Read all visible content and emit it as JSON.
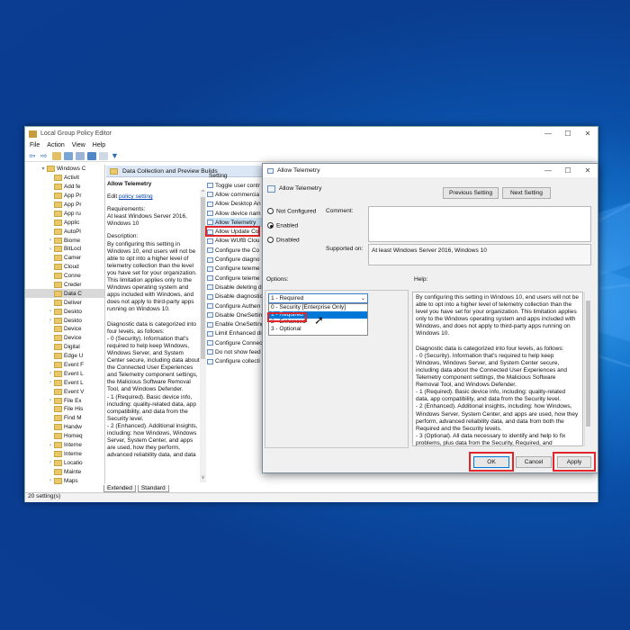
{
  "window": {
    "title": "Local Group Policy Editor",
    "min_glyph": "—",
    "max_glyph": "☐",
    "close_glyph": "✕"
  },
  "menu": [
    "File",
    "Action",
    "View",
    "Help"
  ],
  "tree": [
    {
      "label": "Windows C",
      "caret": "▾"
    },
    {
      "label": "Activit",
      "caret": ""
    },
    {
      "label": "Add fe",
      "caret": ""
    },
    {
      "label": "App Pr",
      "caret": ""
    },
    {
      "label": "App Pr",
      "caret": ""
    },
    {
      "label": "App ru",
      "caret": ""
    },
    {
      "label": "Applic",
      "caret": ""
    },
    {
      "label": "AutoPl",
      "caret": ""
    },
    {
      "label": "Biome",
      "caret": "›"
    },
    {
      "label": "BitLocl",
      "caret": "›"
    },
    {
      "label": "Camer",
      "caret": ""
    },
    {
      "label": "Cloud",
      "caret": ""
    },
    {
      "label": "Conne",
      "caret": ""
    },
    {
      "label": "Creder",
      "caret": ""
    },
    {
      "label": "Data C",
      "caret": ""
    },
    {
      "label": "Deliver",
      "caret": ""
    },
    {
      "label": "Deskto",
      "caret": "›"
    },
    {
      "label": "Deskto",
      "caret": "›"
    },
    {
      "label": "Device",
      "caret": ""
    },
    {
      "label": "Device",
      "caret": ""
    },
    {
      "label": "Digital",
      "caret": ""
    },
    {
      "label": "Edge U",
      "caret": ""
    },
    {
      "label": "Event F",
      "caret": ""
    },
    {
      "label": "Event L",
      "caret": "›"
    },
    {
      "label": "Event L",
      "caret": "›"
    },
    {
      "label": "Event V",
      "caret": ""
    },
    {
      "label": "File Ex",
      "caret": "›"
    },
    {
      "label": "File His",
      "caret": ""
    },
    {
      "label": "Find M",
      "caret": ""
    },
    {
      "label": "Handw",
      "caret": ""
    },
    {
      "label": "Homeq",
      "caret": ""
    },
    {
      "label": "Interne",
      "caret": "›"
    },
    {
      "label": "Interne",
      "caret": ""
    },
    {
      "label": "Locatio",
      "caret": "›"
    },
    {
      "label": "Mainte",
      "caret": ""
    },
    {
      "label": "Maps",
      "caret": "›"
    }
  ],
  "header": {
    "title": "Data Collection and Preview Builds"
  },
  "desc": {
    "title": "Allow Telemetry",
    "edit_prefix": "Edit ",
    "edit_link": "policy setting",
    "requirements": "Requirements:",
    "req_text": "At least Windows Server 2016, Windows 10",
    "description_label": "Description:",
    "body": "By configuring this setting in Windows 10, end users will not be able to opt into a higher level of telemetry collection than the level you have set for your organization. This limitation applies only to the Windows operating system and apps included with Windows, and does not apply to third-party apps running on Windows 10.\n\nDiagnostic data is categorized into four levels, as follows:\n - 0 (Security). Information that's required to help keep Windows, Windows Server, and System Center secure, including data about the Connected User Experiences and Telemetry component settings, the Malicious Software Removal Tool, and Windows Defender.\n - 1 (Required). Basic device info, including: quality-related data, app compatibility, and data from the Security level.\n - 2 (Enhanced). Additional insights, including: how Windows, Windows Server, System Center, and apps are used, how they perform, advanced reliability data, and data"
  },
  "settings": {
    "header": "Setting",
    "items": [
      "Toggle user contr",
      "Allow commercia",
      "Allow Desktop An",
      "Allow device nam",
      "Allow Telemetry",
      "Allow Update Co",
      "Allow WUfB Clou",
      "Configure the Co",
      "Configure diagno",
      "Configure teleme",
      "Configure teleme",
      "Disable deleting d",
      "Disable diagnostic",
      "Configure Authen",
      "Disable OneSettin",
      "Enable OneSetting",
      "Limit Enhanced di",
      "Configure Connec",
      "Do not show feed",
      "Configure collecti"
    ]
  },
  "tabs": [
    "Extended",
    "Standard"
  ],
  "status": "20 setting(s)",
  "dialog": {
    "title": "Allow Telemetry",
    "heading": "Allow Telemetry",
    "prev": "Previous Setting",
    "next": "Next Setting",
    "radios": [
      {
        "label": "Not Configured",
        "checked": false
      },
      {
        "label": "Enabled",
        "checked": true
      },
      {
        "label": "Disabled",
        "checked": false
      }
    ],
    "comment_label": "Comment:",
    "supported_label": "Supported on:",
    "supported_value": "At least Windows Server 2016, Windows 10",
    "options_label": "Options:",
    "help_label": "Help:",
    "select_value": "1 - Required",
    "dropdown": [
      "0 - Security [Enterprise Only]",
      "1 - Required",
      "2 - Enhanced",
      "3 - Optional"
    ],
    "dropdown_selected_index": 1,
    "help_text": "By configuring this setting in Windows 10, end users will not be able to opt into a higher level of telemetry collection than the level you have set for your organization. This limitation applies only to the Windows operating system and apps included with Windows, and does not apply to third-party apps running on Windows 10.\n\nDiagnostic data is categorized into four levels, as follows:\n - 0 (Security). Information that's required to help keep Windows, Windows Server, and System Center secure, including data about the Connected User Experiences and Telemetry component settings, the Malicious Software Removal Tool, and Windows Defender.\n - 1 (Required). Basic device info, including: quality-related data, app compatibility, and data from the Security level.\n - 2 (Enhanced). Additional insights, including: how Windows, Windows Server, System Center, and apps are used, how they perform, advanced reliability data, and data from both the Required and the Security levels.\n - 3 (Optional). All data necessary to identify and help to fix problems, plus data from the Security, Required, and Enhanced",
    "ok": "OK",
    "cancel": "Cancel",
    "apply": "Apply",
    "min_glyph": "—",
    "max_glyph": "☐",
    "close_glyph": "✕"
  },
  "colors": {
    "highlight": "#0078d7",
    "annotation": "#e0262a",
    "desktop": "#0a4fa8"
  }
}
